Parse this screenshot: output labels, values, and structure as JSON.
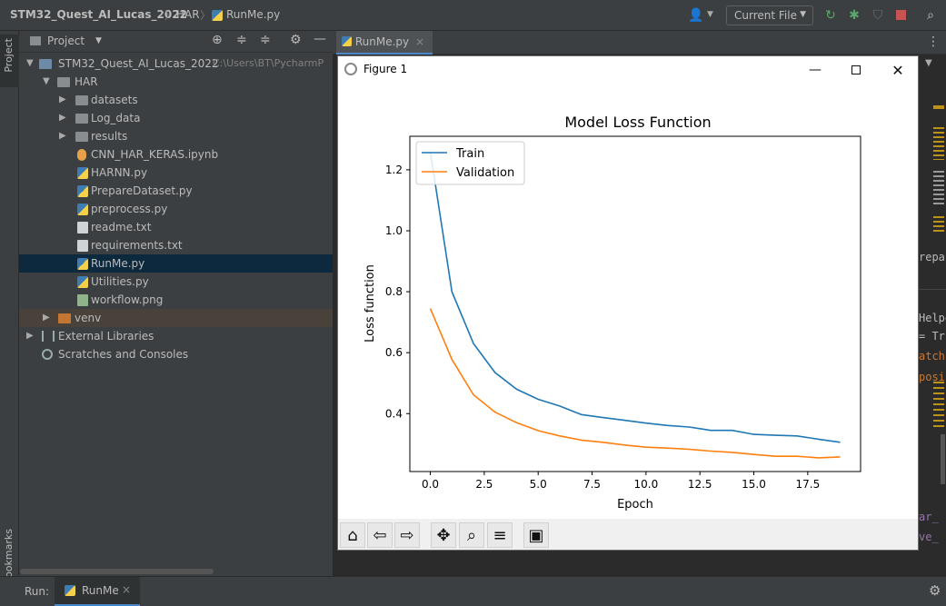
{
  "breadcrumb": {
    "project": "STM32_Quest_AI_Lucas_2022",
    "folder": "HAR",
    "file": "RunMe.py"
  },
  "toolbar": {
    "run_config": "Current File"
  },
  "sidebar": {
    "project_label": "Project",
    "bookmarks_label": "Bookmarks"
  },
  "project_panel": {
    "title": "Project",
    "root_name": "STM32_Quest_AI_Lucas_2022",
    "root_path": "C:\\Users\\BT\\PycharmP",
    "har_folder": "HAR",
    "folders": [
      "datasets",
      "Log_data",
      "results"
    ],
    "files": [
      "CNN_HAR_KERAS.ipynb",
      "HARNN.py",
      "PrepareDataset.py",
      "preprocess.py",
      "readme.txt",
      "requirements.txt",
      "RunMe.py",
      "Utilities.py",
      "workflow.png"
    ],
    "venv": "venv",
    "external_libraries": "External Libraries",
    "scratches": "Scratches and Consoles"
  },
  "editor": {
    "tab_label": "RunMe.py",
    "code_fragments": [
      "repar",
      "Helpe",
      "= Tr",
      "atch",
      "posi",
      "ar_",
      "ve_"
    ]
  },
  "run_bar": {
    "label": "Run:",
    "tab": "RunMe"
  },
  "figure": {
    "window_title": "Figure 1"
  },
  "chart_data": {
    "type": "line",
    "title": "Model Loss Function",
    "xlabel": "Epoch",
    "ylabel": "Loss function",
    "xlim": [
      -0.95,
      19.95
    ],
    "ylim": [
      0.21,
      1.31
    ],
    "xticks": [
      "0.0",
      "2.5",
      "5.0",
      "7.5",
      "10.0",
      "12.5",
      "15.0",
      "17.5"
    ],
    "xtick_values": [
      0,
      2.5,
      5,
      7.5,
      10,
      12.5,
      15,
      17.5
    ],
    "yticks": [
      "0.4",
      "0.6",
      "0.8",
      "1.0",
      "1.2"
    ],
    "ytick_values": [
      0.4,
      0.6,
      0.8,
      1.0,
      1.2
    ],
    "legend_position": "upper-left",
    "x": [
      0,
      1,
      2,
      3,
      4,
      5,
      6,
      7,
      8,
      9,
      10,
      11,
      12,
      13,
      14,
      15,
      16,
      17,
      18,
      19
    ],
    "series": [
      {
        "name": "Train",
        "color": "#1f77b4",
        "values": [
          1.26,
          0.8,
          0.63,
          0.535,
          0.48,
          0.447,
          0.425,
          0.397,
          0.387,
          0.378,
          0.369,
          0.361,
          0.356,
          0.345,
          0.345,
          0.332,
          0.329,
          0.327,
          0.316,
          0.306
        ]
      },
      {
        "name": "Validation",
        "color": "#ff7f0e",
        "values": [
          0.745,
          0.578,
          0.462,
          0.405,
          0.37,
          0.344,
          0.327,
          0.313,
          0.306,
          0.297,
          0.29,
          0.287,
          0.283,
          0.277,
          0.273,
          0.266,
          0.26,
          0.26,
          0.255,
          0.258
        ]
      }
    ]
  }
}
